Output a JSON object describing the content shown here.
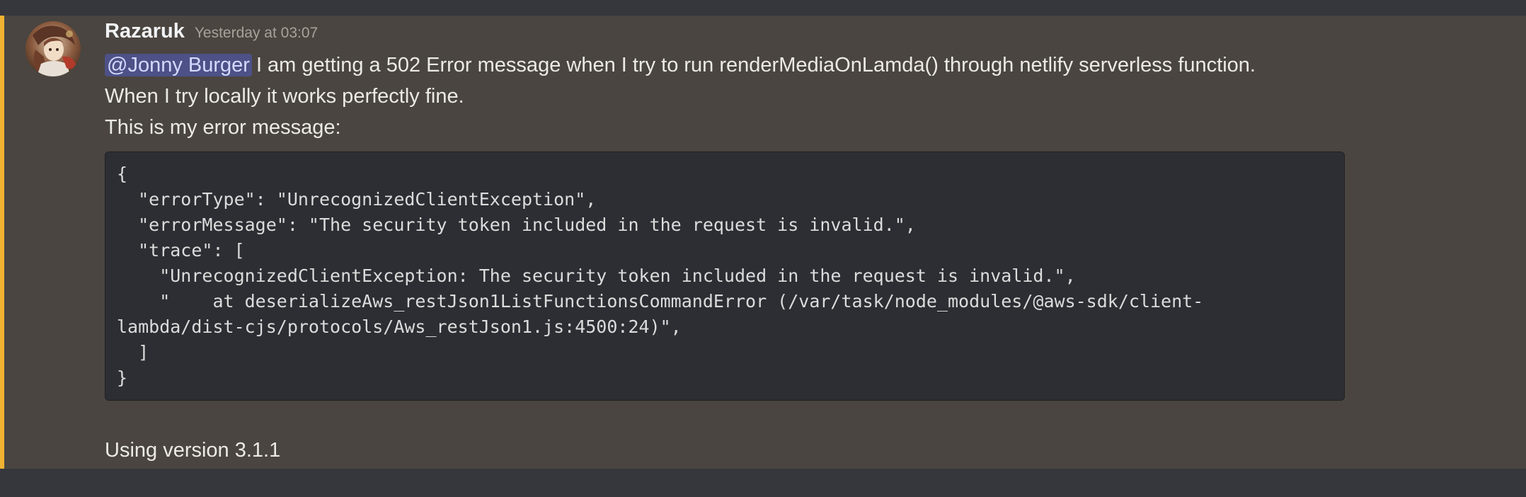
{
  "message": {
    "author": "Razaruk",
    "timestamp": "Yesterday at 03:07",
    "mention": "@Jonny Burger",
    "line1_rest": "I am getting a 502 Error message when I try to run renderMediaOnLamda() through netlify serverless function.",
    "line2": "When I try locally it works perfectly fine.",
    "line3": "This is my error message:",
    "code_lines": [
      "{",
      "  \"errorType\": \"UnrecognizedClientException\",",
      "  \"errorMessage\": \"The security token included in the request is invalid.\",",
      "  \"trace\": [",
      "    \"UnrecognizedClientException: The security token included in the request is invalid.\",",
      "    \"    at deserializeAws_restJson1ListFunctionsCommandError (/var/task/node_modules/@aws-sdk/client-",
      "lambda/dist-cjs/protocols/Aws_restJson1.js:4500:24)\",",
      "  ]",
      "}"
    ],
    "footer": "Using version 3.1.1"
  },
  "colors": {
    "message_bg": "#4a4540",
    "mention_bar": "#f0b232",
    "page_bg": "#35373d",
    "code_bg": "#2d2e33",
    "mention_bg": "#4d5187"
  },
  "icons": {
    "avatar": "anime-character-avatar"
  }
}
